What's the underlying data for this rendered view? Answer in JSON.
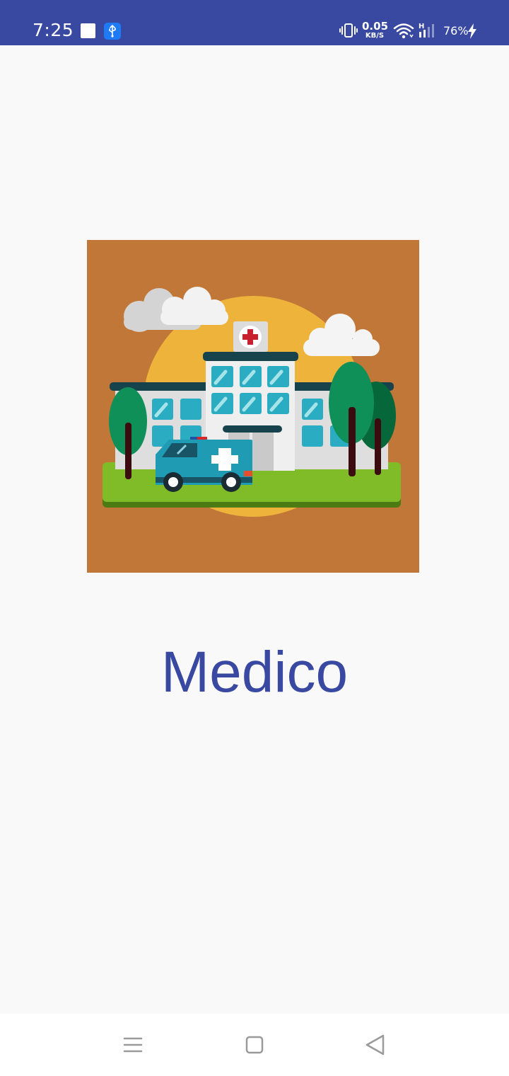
{
  "status_bar": {
    "time": "7:25",
    "network_speed_value": "0.05",
    "network_speed_unit": "KB/S",
    "signal_type": "H",
    "battery": "76%",
    "icons": [
      "notification-square-icon",
      "usb-debug-icon",
      "vibrate-icon",
      "wifi-icon",
      "signal-icon",
      "charging-bolt-icon"
    ]
  },
  "splash": {
    "image": "hospital-illustration",
    "app_name": "Medico"
  },
  "nav_bar": {
    "icons": [
      "recents-menu-icon",
      "home-square-icon",
      "back-triangle-icon"
    ]
  },
  "colors": {
    "status_bar": "#3949a1",
    "title": "#3949a1",
    "image_bg": "#c07738",
    "page_bg": "#f9f9f9"
  }
}
